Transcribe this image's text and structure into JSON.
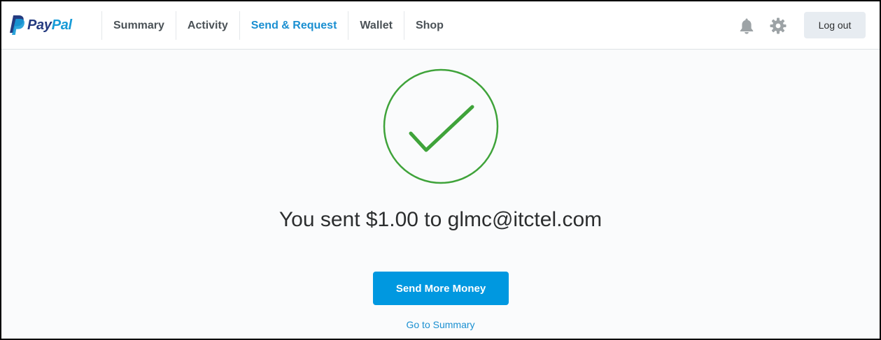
{
  "brand": {
    "name_part1": "Pay",
    "name_part2": "Pal",
    "colors": {
      "dark": "#253b80",
      "light": "#179bd7"
    }
  },
  "nav": {
    "tabs": [
      {
        "label": "Summary",
        "active": false
      },
      {
        "label": "Activity",
        "active": false
      },
      {
        "label": "Send & Request",
        "active": true
      },
      {
        "label": "Wallet",
        "active": false
      },
      {
        "label": "Shop",
        "active": false
      }
    ],
    "icons": [
      "bell-icon",
      "gear-icon"
    ],
    "logout_label": "Log out"
  },
  "confirmation": {
    "icon": "checkmark-icon",
    "message": "You sent $1.00 to glmc@itctel.com",
    "primary_button": "Send More Money",
    "secondary_link": "Go to Summary"
  },
  "colors": {
    "accent": "#0098e0",
    "link": "#1a8fd1",
    "success": "#3fa33a",
    "text": "#2c2e2f"
  }
}
